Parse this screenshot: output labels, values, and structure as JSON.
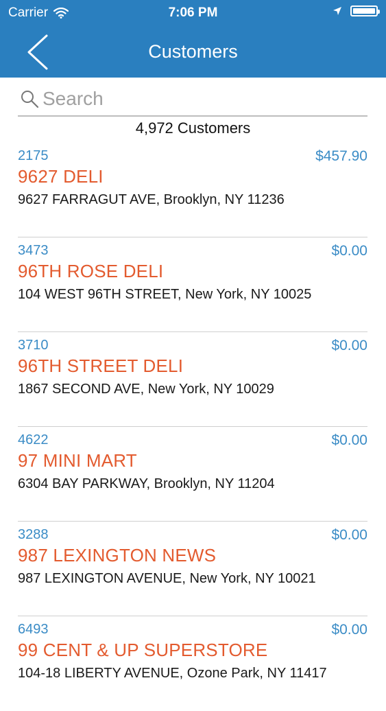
{
  "status_bar": {
    "carrier": "Carrier",
    "time": "7:06 PM"
  },
  "nav": {
    "title": "Customers",
    "back_icon": "chevron-left-icon"
  },
  "search": {
    "placeholder": "Search",
    "value": ""
  },
  "count_label": "4,972 Customers",
  "customers": [
    {
      "id": "2175",
      "amount": "$457.90",
      "name": "9627 DELI",
      "address": "9627 FARRAGUT AVE, Brooklyn, NY 11236"
    },
    {
      "id": "3473",
      "amount": "$0.00",
      "name": "96TH ROSE DELI",
      "address": "104 WEST 96TH STREET, New York, NY 10025"
    },
    {
      "id": "3710",
      "amount": "$0.00",
      "name": "96TH STREET DELI",
      "address": "1867 SECOND AVE, New York, NY 10029"
    },
    {
      "id": "4622",
      "amount": "$0.00",
      "name": "97 MINI MART",
      "address": "6304 BAY PARKWAY, Brooklyn, NY 11204"
    },
    {
      "id": "3288",
      "amount": "$0.00",
      "name": "987 LEXINGTON NEWS",
      "address": "987 LEXINGTON AVENUE, New York, NY 10021"
    },
    {
      "id": "6493",
      "amount": "$0.00",
      "name": "99 CENT & UP SUPERSTORE",
      "address": "104-18 LIBERTY AVENUE, Ozone Park, NY 11417"
    }
  ],
  "colors": {
    "header": "#2a7fbf",
    "accent_blue": "#3b8cc6",
    "name_orange": "#e35b2f"
  }
}
